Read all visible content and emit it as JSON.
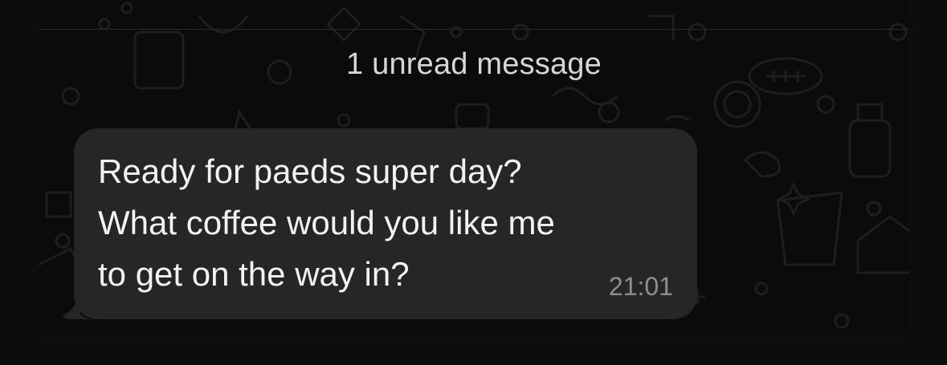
{
  "banner": {
    "unread_label": "1 unread message"
  },
  "message": {
    "text": "Ready for paeds super day?\nWhat coffee would you like me\nto get on the way in?",
    "time": "21:01"
  },
  "colors": {
    "background": "#0d0d0d",
    "bubble": "#262626",
    "message_text": "#f2f2f2",
    "timestamp": "#8e8e8e",
    "banner_text": "#d6d6d6"
  },
  "icons": [
    "doodle-wallpaper-icons"
  ]
}
